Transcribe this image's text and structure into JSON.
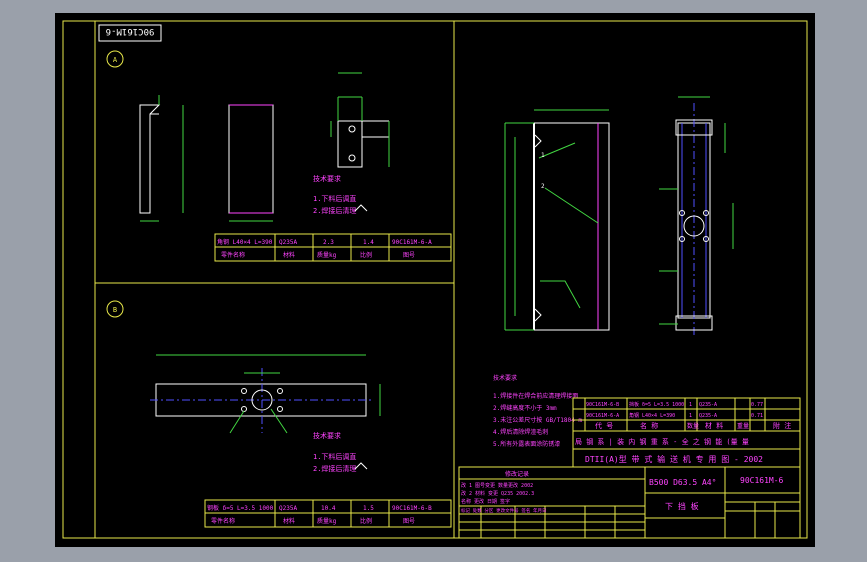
{
  "title_block": {
    "drawing_number": "90C161M-6",
    "drawing_number_mirrored": "90C161M-6",
    "series_line": "DTII(A)型  带 式 输 送 机 专 用 图 - 2002",
    "spec_line": "B500 D63.5 A4°",
    "part_name": "下 挡 板",
    "marks_header": "标记  处数  分区  更改文件号  签名  年月日",
    "table_header_code": "代  号",
    "table_header_name": "名  称",
    "table_header_qty": "数量",
    "table_header_material": "材  料",
    "table_header_weight": "重量",
    "table_header_note": "附  注",
    "company_line": "局 钢 系  | 装 内 钢 重 系 - 全 之 钢 能 (量 量"
  },
  "parts_list": [
    {
      "code": "90C161M-6-B",
      "name": "挡板 δ=5 L=3.5 1000",
      "qty": "1",
      "material": "Q235-A",
      "note": "0.77"
    },
    {
      "code": "90C161M-6-A",
      "name": "角钢 L40×4 L=390",
      "qty": "1",
      "material": "Q235-A",
      "note": "0.71"
    }
  ],
  "notes_main": {
    "title": "技术要求",
    "lines": [
      "1.焊接件在焊合前应清理焊接面",
      "2.焊缝高度不小于 3mm",
      "3.未注公差尺寸按 GB/T1804-m",
      "4.焊后清除焊渣毛刺",
      "5.所有外露表面涂防锈漆"
    ]
  },
  "view_a": {
    "label": "A",
    "mark_title": "技术要求",
    "mark1": "1.下料后调直",
    "mark2": "2.焊接后清理",
    "row1": [
      "角钢 L40×4 L=390",
      "Q235A",
      "2.3",
      "1.4",
      "90C161M-6-A"
    ],
    "row2": [
      "零件名称",
      "材料",
      "质量kg",
      "比例",
      "图号"
    ]
  },
  "view_b": {
    "label": "B",
    "mark_title": "技术要求",
    "mark1": "1.下料后调直",
    "mark2": "2.焊接后清理",
    "row1": [
      "钢板 δ=5 L=3.5 1000",
      "Q235A",
      "10.4",
      "1.5",
      "90C161M-6-B"
    ],
    "row2": [
      "零件名称",
      "材料",
      "质量kg",
      "比例",
      "图号"
    ]
  },
  "revision_block": {
    "title": "修改记录",
    "rows": [
      "改 1  图号变更 数量更改 2002",
      "改 2  材料 变更 Q235 2002.3",
      "名称  更改 日期 签字"
    ]
  },
  "colors": {
    "frame": "#e8e84a",
    "dim": "#42d742",
    "text": "#ff44ff",
    "geometry": "#ffffff",
    "centerline": "#5050ff"
  }
}
